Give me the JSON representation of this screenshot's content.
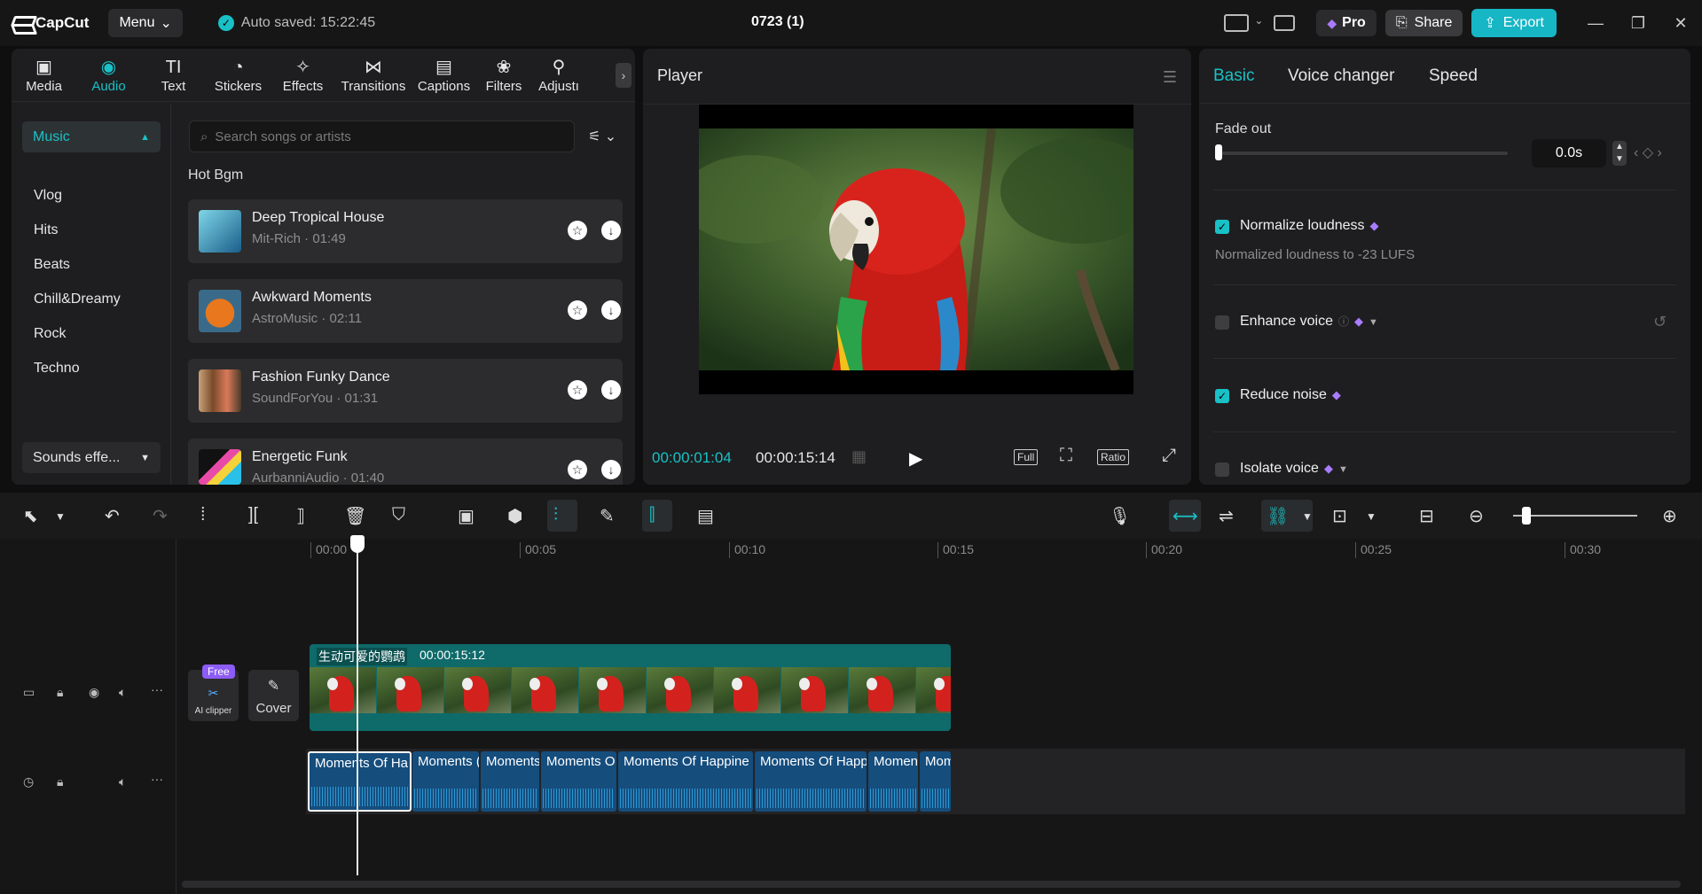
{
  "app": {
    "logo": "CapCut",
    "menu_label": "Menu",
    "autosave": "Auto saved: 15:22:45",
    "title": "0723 (1)",
    "pro_label": "Pro",
    "share_label": "Share",
    "export_label": "Export",
    "accent_color": "#19c1c6"
  },
  "toolbar": {
    "tools": [
      {
        "label": "Media",
        "icon": "media-icon"
      },
      {
        "label": "Audio",
        "icon": "audio-icon"
      },
      {
        "label": "Text",
        "icon": "text-icon"
      },
      {
        "label": "Stickers",
        "icon": "sticker-icon"
      },
      {
        "label": "Effects",
        "icon": "effects-icon"
      },
      {
        "label": "Transitions",
        "icon": "transitions-icon"
      },
      {
        "label": "Captions",
        "icon": "captions-icon"
      },
      {
        "label": "Filters",
        "icon": "filters-icon"
      },
      {
        "label": "Adjustı",
        "icon": "adjust-icon"
      }
    ],
    "active_tool": "Audio"
  },
  "categories": {
    "active": "Music",
    "items": [
      "Vlog",
      "Hits",
      "Beats",
      "Chill&Dreamy",
      "Rock",
      "Techno"
    ],
    "sounds": "Sounds effe..."
  },
  "music": {
    "search_placeholder": "Search songs or artists",
    "section_title": "Hot Bgm",
    "songs": [
      {
        "name": "Deep Tropical House",
        "meta": "Mit-Rich · 01:49"
      },
      {
        "name": "Awkward Moments",
        "meta": "AstroMusic · 02:11"
      },
      {
        "name": "Fashion Funky Dance",
        "meta": "SoundForYou · 01:31"
      },
      {
        "name": "Energetic Funk",
        "meta": "AurbanniAudio · 01:40"
      }
    ]
  },
  "player": {
    "title": "Player",
    "current_time": "00:00:01:04",
    "total_time": "00:00:15:14",
    "full_label": "Full",
    "ratio_label": "Ratio"
  },
  "properties": {
    "tabs": [
      "Basic",
      "Voice changer",
      "Speed"
    ],
    "active_tab": "Basic",
    "fade_out_label": "Fade out",
    "fade_out_value": "0.0s",
    "normalize_label": "Normalize loudness",
    "normalize_sub": "Normalized loudness to -23 LUFS",
    "normalize_on": true,
    "enhance_label": "Enhance voice",
    "enhance_on": false,
    "reduce_label": "Reduce noise",
    "reduce_on": true,
    "isolate_label": "Isolate voice",
    "isolate_on": false
  },
  "timeline": {
    "ruler": [
      "00:00",
      "00:05",
      "00:10",
      "00:15",
      "00:20",
      "00:25",
      "00:30"
    ],
    "video_clip_label": "生动可爱的鹦鹉",
    "video_clip_duration": "00:00:15:12",
    "ai_clipper_badge": "Free",
    "ai_clipper_label": "AI clipper",
    "cover_label": "Cover",
    "audio_clips": [
      "Moments Of Ha",
      "Moments (",
      "Moments",
      "Moments O",
      "Moments Of Happine",
      "Moments Of Happ",
      "Momen",
      "Mom"
    ]
  }
}
